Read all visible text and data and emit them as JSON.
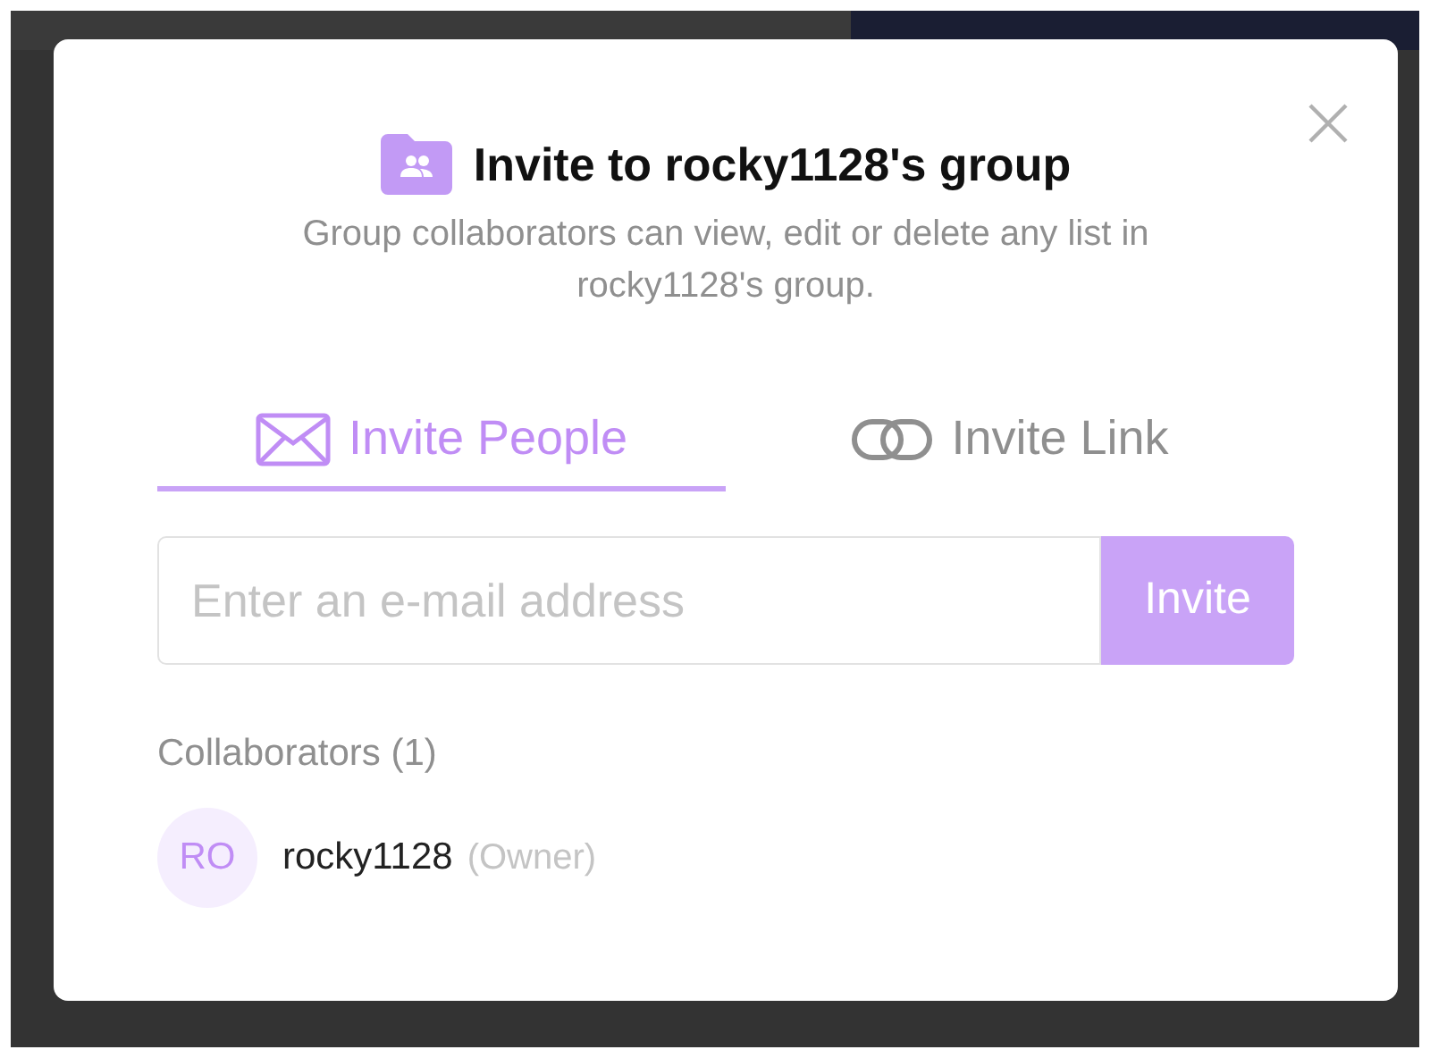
{
  "dialog": {
    "title": "Invite to rocky1128's group",
    "description": "Group collaborators can view, edit or delete any list in rocky1128's group.",
    "tabs": [
      {
        "kind": "mail",
        "label": "Invite People",
        "selected": true
      },
      {
        "kind": "link",
        "label": "Invite Link",
        "selected": false
      }
    ],
    "email_field": {
      "placeholder": "Enter an e-mail address"
    },
    "invite_button": "Invite",
    "collaborators_heading": "Collaborators (1)",
    "collaborators": [
      {
        "initials": "RO",
        "name": "rocky1128",
        "role": "(Owner)"
      }
    ]
  }
}
